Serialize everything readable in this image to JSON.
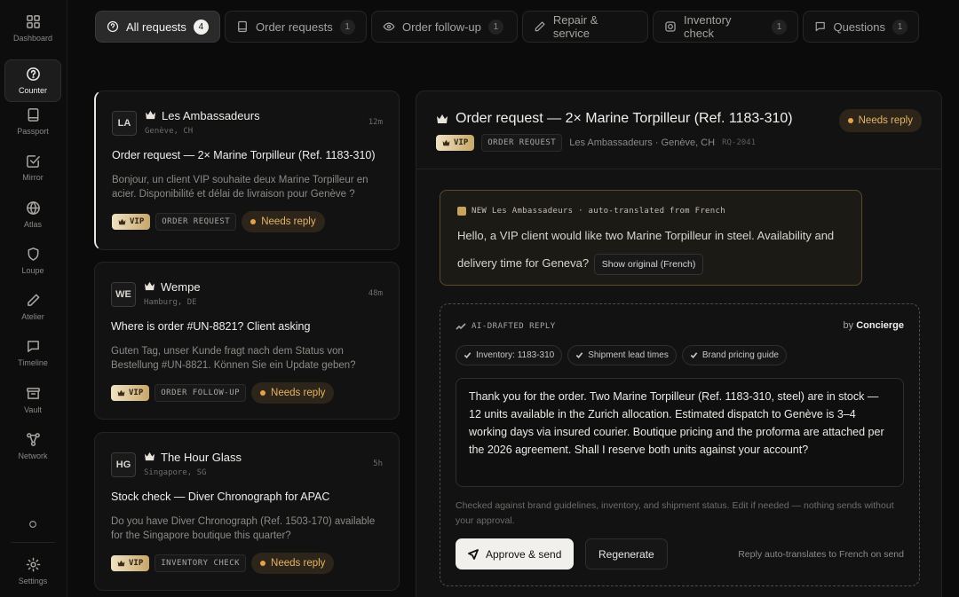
{
  "sidebar": {
    "items": [
      {
        "label": "Dashboard",
        "icon": "dashboard-icon"
      },
      {
        "label": "Counter",
        "icon": "question-icon"
      },
      {
        "label": "Passport",
        "icon": "passport-icon"
      },
      {
        "label": "Mirror",
        "icon": "checkbox-icon"
      },
      {
        "label": "Atlas",
        "icon": "globe-icon"
      },
      {
        "label": "Loupe",
        "icon": "shield-icon"
      },
      {
        "label": "Atelier",
        "icon": "pen-icon"
      },
      {
        "label": "Timeline",
        "icon": "timeline-icon"
      },
      {
        "label": "Vault",
        "icon": "archive-icon"
      },
      {
        "label": "Network",
        "icon": "network-icon"
      }
    ],
    "settings_label": "Settings"
  },
  "tabs": [
    {
      "label": "All requests",
      "count": "4"
    },
    {
      "label": "Order requests",
      "count": "1"
    },
    {
      "label": "Order follow-up",
      "count": "1"
    },
    {
      "label": "Repair & service",
      "count": ""
    },
    {
      "label": "Inventory check",
      "count": "1"
    },
    {
      "label": "Questions",
      "count": "1"
    }
  ],
  "requests": [
    {
      "initials": "LA",
      "sender": "Les Ambassadeurs",
      "location": "Genève, CH",
      "time": "12m",
      "subject": "Order request — 2× Marine Torpilleur (Ref. 1183-310)",
      "preview": "Bonjour, un client VIP souhaite deux Marine Torpilleur en acier. Disponibilité et délai de livraison pour Genève ?",
      "vip": "VIP",
      "type": "ORDER REQUEST",
      "status": "Needs reply"
    },
    {
      "initials": "WE",
      "sender": "Wempe",
      "location": "Hamburg, DE",
      "time": "48m",
      "subject": "Where is order #UN-8821? Client asking",
      "preview": "Guten Tag, unser Kunde fragt nach dem Status von Bestellung #UN-8821. Können Sie ein Update geben?",
      "vip": "VIP",
      "type": "ORDER FOLLOW-UP",
      "status": "Needs reply"
    },
    {
      "initials": "HG",
      "sender": "The Hour Glass",
      "location": "Singapore, SG",
      "time": "5h",
      "subject": "Stock check — Diver Chronograph for APAC",
      "preview": "Do you have Diver Chronograph (Ref. 1503-170) available for the Singapore boutique this quarter?",
      "vip": "VIP",
      "type": "INVENTORY CHECK",
      "status": "Needs reply"
    }
  ],
  "detail": {
    "title": "Order request — 2× Marine Torpilleur (Ref. 1183-310)",
    "status": "Needs reply",
    "vip": "VIP",
    "type": "ORDER REQUEST",
    "meta": "Les Ambassadeurs · Genève, CH",
    "ref": "RQ-2041",
    "translated": {
      "header": "NEW  Les Ambassadeurs · auto-translated from French",
      "text": "Hello, a VIP client would like two Marine Torpilleur in steel. Availability and delivery time for Geneva?",
      "show_original": "Show original (French)"
    },
    "draft": {
      "header": "AI-DRAFTED REPLY",
      "by_prefix": "by",
      "by_name": "Concierge",
      "chips": [
        "Inventory: 1183-310",
        "Shipment lead times",
        "Brand pricing guide"
      ],
      "reply": "Thank you for the order. Two Marine Torpilleur (Ref. 1183-310, steel) are in stock — 12 units available in the Zurich allocation. Estimated dispatch to Genève is 3–4 working days via insured courier. Boutique pricing and the proforma are attached per the 2026 agreement. Shall I reserve both units against your account?",
      "note": "Checked against brand guidelines, inventory, and shipment status. Edit if needed — nothing sends without your approval.",
      "approve_label": "Approve & send",
      "regenerate_label": "Regenerate",
      "auto_note": "Reply auto-translates to French on send"
    }
  }
}
